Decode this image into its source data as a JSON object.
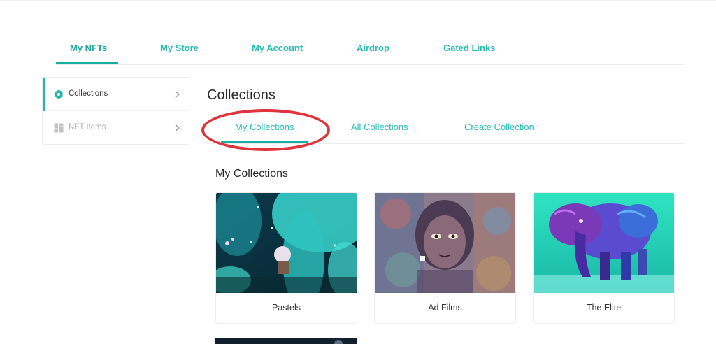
{
  "top_tabs": [
    {
      "label": "My NFTs",
      "active": true
    },
    {
      "label": "My Store"
    },
    {
      "label": "My Account"
    },
    {
      "label": "Airdrop"
    },
    {
      "label": "Gated Links"
    }
  ],
  "sidebar": {
    "items": [
      {
        "label": "Collections",
        "icon": "hexagon-icon",
        "active": true
      },
      {
        "label": "NFT Items",
        "icon": "grid-icon"
      }
    ]
  },
  "main": {
    "title": "Collections",
    "sub_tabs": [
      {
        "label": "My Collections",
        "active": true
      },
      {
        "label": "All Collections"
      },
      {
        "label": "Create Collection"
      }
    ],
    "section_title": "My Collections",
    "collections": [
      {
        "name": "Pastels",
        "thumbnail": "teal-fantasy-artwork"
      },
      {
        "name": "Ad Films",
        "thumbnail": "psychedelic-portrait-artwork"
      },
      {
        "name": "The Elite",
        "thumbnail": "neon-elephant-artwork"
      }
    ]
  },
  "colors": {
    "accent": "#1db8ac",
    "tab_text": "#27bdb3",
    "annotation": "#e0333a"
  }
}
